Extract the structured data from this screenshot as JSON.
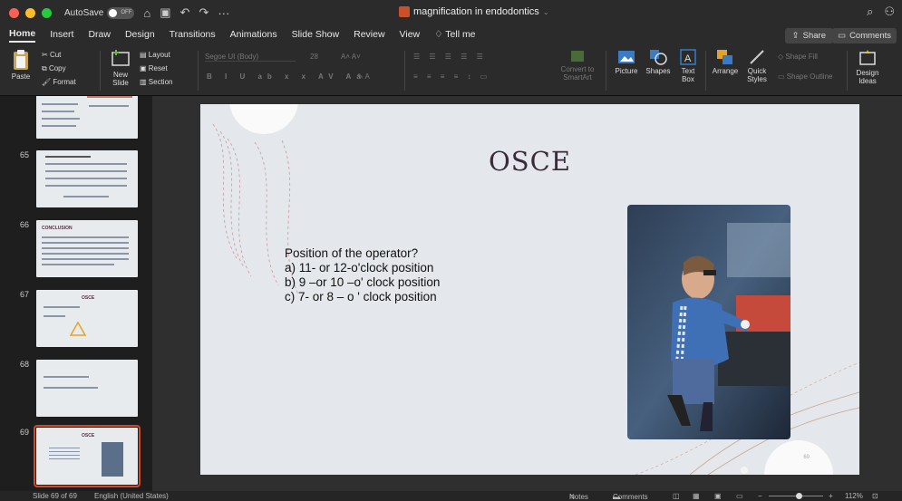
{
  "titlebar": {
    "autosave_label": "AutoSave",
    "autosave_state": "OFF",
    "doc_title": "magnification in endodontics",
    "traffic_colors": [
      "#fe5f57",
      "#febc2e",
      "#28c840"
    ]
  },
  "tabs": [
    "Home",
    "Insert",
    "Draw",
    "Design",
    "Transitions",
    "Animations",
    "Slide Show",
    "Review",
    "View",
    "Tell me"
  ],
  "share_label": "Share",
  "comments_label": "Comments",
  "ribbon": {
    "paste": "Paste",
    "cut": "Cut",
    "copy": "Copy",
    "format": "Format",
    "new_slide": "New Slide",
    "layout": "Layout",
    "reset": "Reset",
    "section": "Section",
    "font_name": "Segoe UI (Body)",
    "font_size": "28",
    "convert": "Convert to SmartArt",
    "picture": "Picture",
    "shapes": "Shapes",
    "text_box": "Text Box",
    "arrange": "Arrange",
    "quick_styles": "Quick Styles",
    "shape_fill": "Shape Fill",
    "shape_outline": "Shape Outline",
    "design_ideas": "Design Ideas"
  },
  "thumbnails": [
    {
      "num": "",
      "title": ""
    },
    {
      "num": "65",
      "title": ""
    },
    {
      "num": "66",
      "title": "CONCLUSION"
    },
    {
      "num": "67",
      "title": "OSCE"
    },
    {
      "num": "68",
      "title": ""
    },
    {
      "num": "69",
      "title": "OSCE"
    }
  ],
  "slide": {
    "title": "OSCE",
    "question": "Position of the operator?",
    "options": [
      "a)  11- or 12-o'clock position",
      "b)  9 –or 10 –o' clock position",
      "c)  7- or 8 – o ' clock position"
    ],
    "page_number": "69"
  },
  "status": {
    "slide_info": "Slide 69 of 69",
    "language": "English (United States)",
    "notes": "Notes",
    "comments": "Comments",
    "zoom": "112%"
  }
}
